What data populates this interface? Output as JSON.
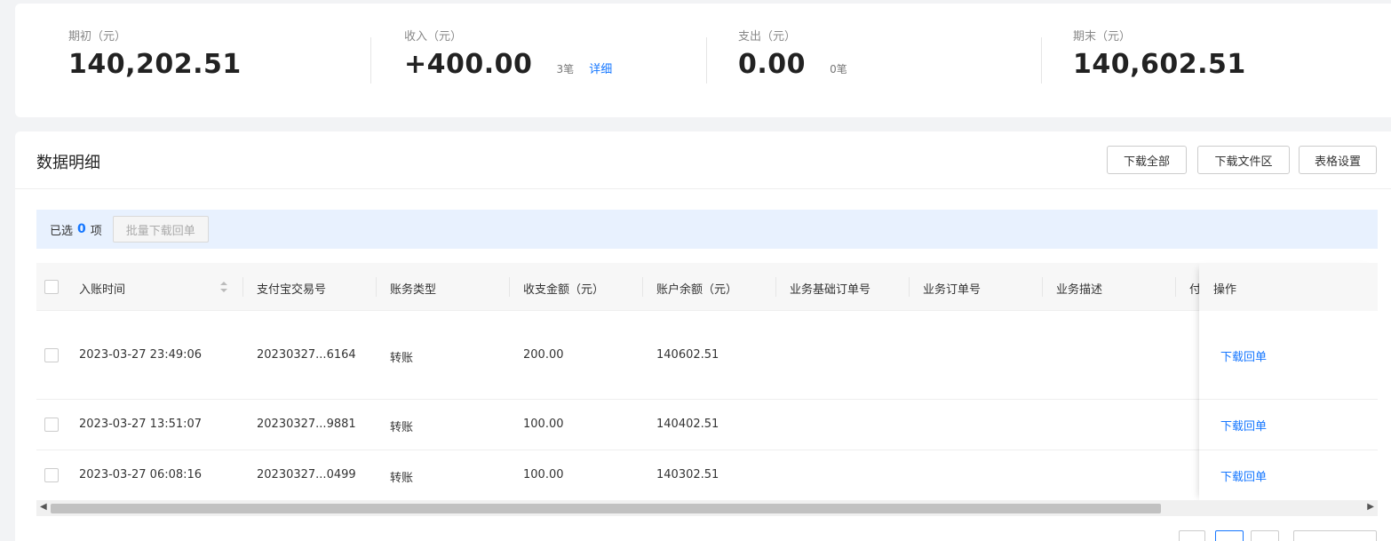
{
  "summary": {
    "opening": {
      "label": "期初（元）",
      "value": "140,202.51"
    },
    "income": {
      "label": "收入（元）",
      "value": "+400.00",
      "count": "3笔",
      "link": "详细"
    },
    "expense": {
      "label": "支出（元）",
      "value": "0.00",
      "count": "0笔"
    },
    "closing": {
      "label": "期末（元）",
      "value": "140,602.51"
    }
  },
  "detail": {
    "title": "数据明细",
    "buttons": {
      "download_all": "下载全部",
      "download_area": "下载文件区",
      "table_settings": "表格设置"
    },
    "selection": {
      "prefix": "已选",
      "count": "0",
      "suffix": "项",
      "batch_label": "批量下载回单"
    },
    "columns": [
      "入账时间",
      "支付宝交易号",
      "账务类型",
      "收支金额（元）",
      "账户余额（元）",
      "业务基础订单号",
      "业务订单号",
      "业务描述",
      "付",
      "操作"
    ],
    "rows": [
      {
        "time": "2023-03-27 23:49:06",
        "trade_no": "20230327...6164",
        "type": "转账",
        "amount": "200.00",
        "balance": "140602.51",
        "action": "下载回单"
      },
      {
        "time": "2023-03-27 13:51:07",
        "trade_no": "20230327...9881",
        "type": "转账",
        "amount": "100.00",
        "balance": "140402.51",
        "action": "下载回单"
      },
      {
        "time": "2023-03-27 06:08:16",
        "trade_no": "20230327...0499",
        "type": "转账",
        "amount": "100.00",
        "balance": "140302.51",
        "action": "下载回单"
      }
    ]
  }
}
